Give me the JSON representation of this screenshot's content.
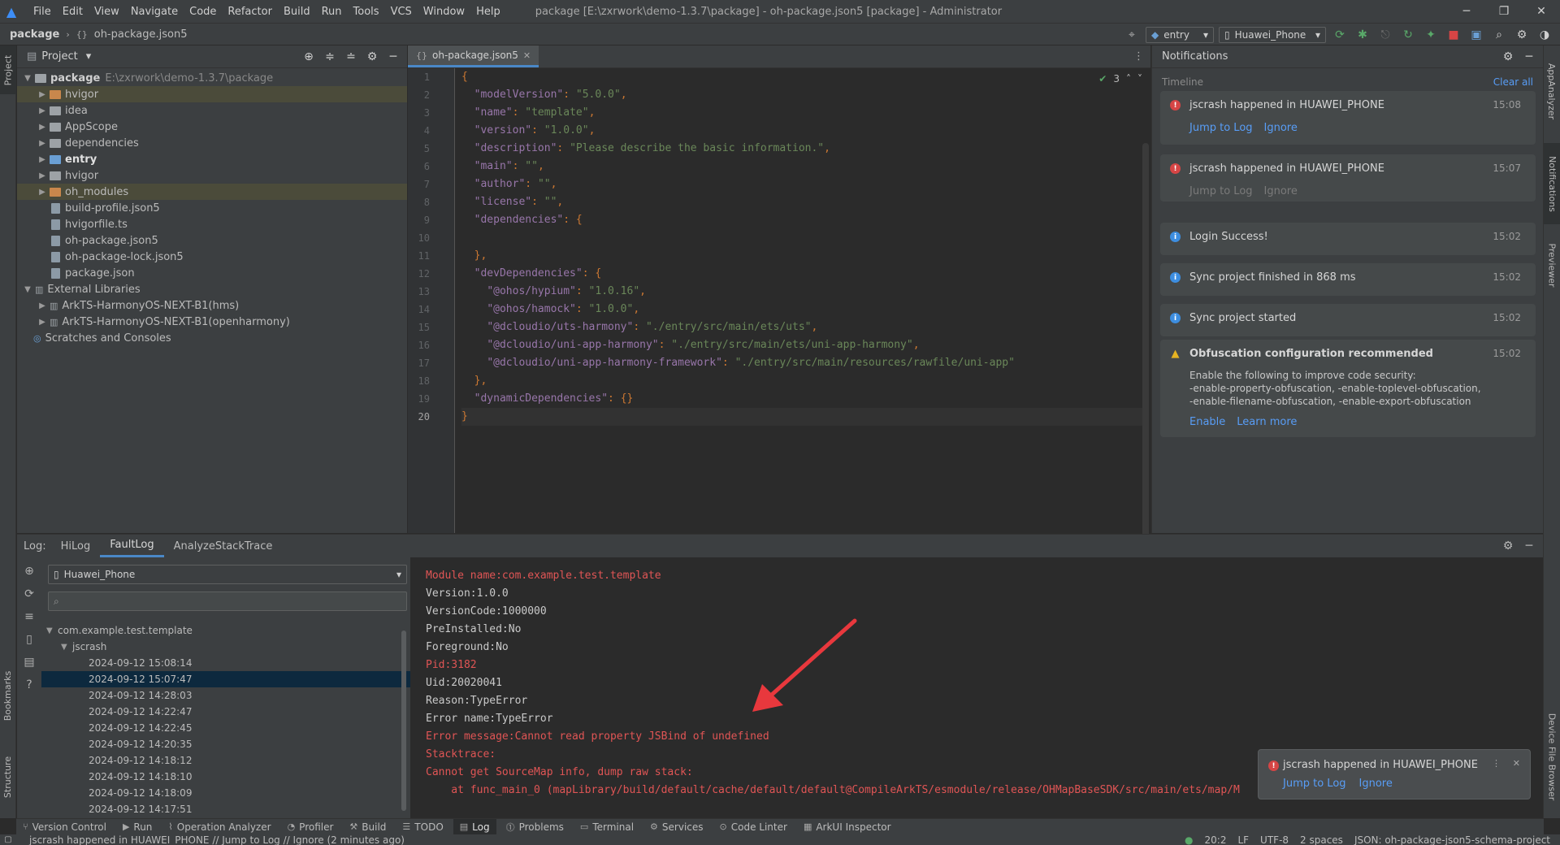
{
  "titlebar": {
    "menu": [
      "File",
      "Edit",
      "View",
      "Navigate",
      "Code",
      "Refactor",
      "Build",
      "Run",
      "Tools",
      "VCS",
      "Window",
      "Help"
    ],
    "title": "package [E:\\zxrwork\\demo-1.3.7\\package] - oh-package.json5 [package] - Administrator"
  },
  "navbar": {
    "project": "package",
    "file": "oh-package.json5",
    "module_combo": "entry",
    "device_combo": "Huawei_Phone"
  },
  "left_stripe": {
    "project": "Project",
    "bookmarks": "Bookmarks",
    "structure": "Structure"
  },
  "right_stripe": {
    "appanalyzer": "AppAnalyzer",
    "notifications": "Notifications",
    "previewer": "Previewer",
    "device_file_browser": "Device File Browser"
  },
  "project_panel": {
    "title": "Project",
    "root": {
      "name": "package",
      "path": "E:\\zxrwork\\demo-1.3.7\\package"
    },
    "items": [
      {
        "label": "hvigor",
        "kind": "folder-orange",
        "arrow": true,
        "bold": false,
        "sel": true
      },
      {
        "label": "idea",
        "kind": "folder",
        "arrow": true,
        "bold": false,
        "sel": false
      },
      {
        "label": "AppScope",
        "kind": "folder",
        "arrow": true,
        "bold": false,
        "sel": false
      },
      {
        "label": "dependencies",
        "kind": "folder",
        "arrow": true,
        "bold": false,
        "sel": false
      },
      {
        "label": "entry",
        "kind": "folder-blue",
        "arrow": true,
        "bold": true,
        "sel": false
      },
      {
        "label": "hvigor",
        "kind": "folder",
        "arrow": true,
        "bold": false,
        "sel": false
      },
      {
        "label": "oh_modules",
        "kind": "folder-orange",
        "arrow": true,
        "bold": false,
        "sel": true
      },
      {
        "label": "build-profile.json5",
        "kind": "file",
        "arrow": false,
        "bold": false,
        "sel": false
      },
      {
        "label": "hvigorfile.ts",
        "kind": "file",
        "arrow": false,
        "bold": false,
        "sel": false
      },
      {
        "label": "oh-package.json5",
        "kind": "file",
        "arrow": false,
        "bold": false,
        "sel": false
      },
      {
        "label": "oh-package-lock.json5",
        "kind": "file",
        "arrow": false,
        "bold": false,
        "sel": false
      },
      {
        "label": "package.json",
        "kind": "file",
        "arrow": false,
        "bold": false,
        "sel": false
      }
    ],
    "external_libraries": "External Libraries",
    "libraries": [
      "ArkTS-HarmonyOS-NEXT-B1(hms)",
      "ArkTS-HarmonyOS-NEXT-B1(openharmony)"
    ],
    "scratches": "Scratches and Consoles"
  },
  "editor": {
    "tab": "oh-package.json5",
    "warning_count": "3",
    "lines": [
      "{",
      "  \"modelVersion\": \"5.0.0\",",
      "  \"name\": \"template\",",
      "  \"version\": \"1.0.0\",",
      "  \"description\": \"Please describe the basic information.\",",
      "  \"main\": \"\",",
      "  \"author\": \"\",",
      "  \"license\": \"\",",
      "  \"dependencies\": {",
      "",
      "  },",
      "  \"devDependencies\": {",
      "    \"@ohos/hypium\": \"1.0.16\",",
      "    \"@ohos/hamock\": \"1.0.0\",",
      "    \"@dcloudio/uts-harmony\": \"./entry/src/main/ets/uts\",",
      "    \"@dcloudio/uni-app-harmony\": \"./entry/src/main/ets/uni-app-harmony\",",
      "    \"@dcloudio/uni-app-harmony-framework\": \"./entry/src/main/resources/rawfile/uni-app\"",
      "  },",
      "  \"dynamicDependencies\": {}",
      "}"
    ],
    "line_numbers": [
      "1",
      "2",
      "3",
      "4",
      "5",
      "6",
      "7",
      "8",
      "9",
      "10",
      "11",
      "12",
      "13",
      "14",
      "15",
      "16",
      "17",
      "18",
      "19",
      "20"
    ]
  },
  "notifications": {
    "title": "Notifications",
    "timeline": "Timeline",
    "clear_all": "Clear all",
    "items": [
      {
        "type": "err",
        "title": "jscrash happened in HUAWEI_PHONE",
        "time": "15:08",
        "actions": [
          "Jump to Log",
          "Ignore"
        ],
        "dim": false
      },
      {
        "type": "err",
        "title": "jscrash happened in HUAWEI_PHONE",
        "time": "15:07",
        "actions": [
          "Jump to Log",
          "Ignore"
        ],
        "dim": true
      },
      {
        "type": "inf",
        "title": "Login Success!",
        "time": "15:02"
      },
      {
        "type": "inf",
        "title": "Sync project finished in 868 ms",
        "time": "15:02"
      },
      {
        "type": "inf",
        "title": "Sync project started",
        "time": "15:02"
      }
    ],
    "obfuscation": {
      "title": "Obfuscation configuration recommended",
      "time": "15:02",
      "body": [
        "Enable the following to improve code security:",
        "-enable-property-obfuscation, -enable-toplevel-obfuscation,",
        "-enable-filename-obfuscation, -enable-export-obfuscation"
      ],
      "actions": [
        "Enable",
        "Learn more"
      ]
    }
  },
  "log": {
    "label": "Log:",
    "tabs": [
      "HiLog",
      "FaultLog",
      "AnalyzeStackTrace"
    ],
    "device": "Huawei_Phone",
    "package": "com.example.test.template",
    "crash_type": "jscrash",
    "timestamps": [
      "2024-09-12 15:08:14",
      "2024-09-12 15:07:47",
      "2024-09-12 14:28:03",
      "2024-09-12 14:22:47",
      "2024-09-12 14:22:45",
      "2024-09-12 14:20:35",
      "2024-09-12 14:18:12",
      "2024-09-12 14:18:10",
      "2024-09-12 14:18:09",
      "2024-09-12 14:17:51"
    ],
    "lines": [
      {
        "text": "Module name:com.example.test.template",
        "red": true
      },
      {
        "text": "Version:1.0.0",
        "red": false
      },
      {
        "text": "VersionCode:1000000",
        "red": false
      },
      {
        "text": "PreInstalled:No",
        "red": false
      },
      {
        "text": "Foreground:No",
        "red": false
      },
      {
        "text": "Pid:3182",
        "red": true
      },
      {
        "text": "Uid:20020041",
        "red": false
      },
      {
        "text": "Reason:TypeError",
        "red": false
      },
      {
        "text": "Error name:TypeError",
        "red": false
      },
      {
        "text": "Error message:Cannot read property JSBind of undefined",
        "red": true
      },
      {
        "text": "Stacktrace:",
        "red": true
      },
      {
        "text": "Cannot get SourceMap info, dump raw stack:",
        "red": true
      },
      {
        "text": "    at func_main_0 (mapLibrary/build/default/cache/default/default@CompileArkTS/esmodule/release/OHMapBaseSDK/src/main/ets/map/M",
        "red": true
      }
    ]
  },
  "toast": {
    "title": "jscrash happened in HUAWEI_PHONE",
    "actions": [
      "Jump to Log",
      "Ignore"
    ]
  },
  "toolwindows": [
    "Version Control",
    "Run",
    "Operation Analyzer",
    "Profiler",
    "Build",
    "TODO",
    "Log",
    "Problems",
    "Terminal",
    "Services",
    "Code Linter",
    "ArkUI Inspector"
  ],
  "toolwindow_glyphs": [
    "⑂",
    "▶",
    "⌇",
    "◔",
    "⚒",
    "☰",
    "▤",
    "⓵",
    "▭",
    "⚙",
    "⊙",
    "▦"
  ],
  "statusbar": {
    "message": "jscrash happened in HUAWEI_PHONE // Jump to Log // Ignore (2 minutes ago)",
    "position": "20:2",
    "line_sep": "LF",
    "encoding": "UTF-8",
    "indent": "2 spaces",
    "schema": "JSON: oh-package-json5-schema-project"
  },
  "colors": {
    "accent": "#4a88c7",
    "error": "#e05555",
    "link": "#589df6",
    "arrow": "#e8383d"
  }
}
